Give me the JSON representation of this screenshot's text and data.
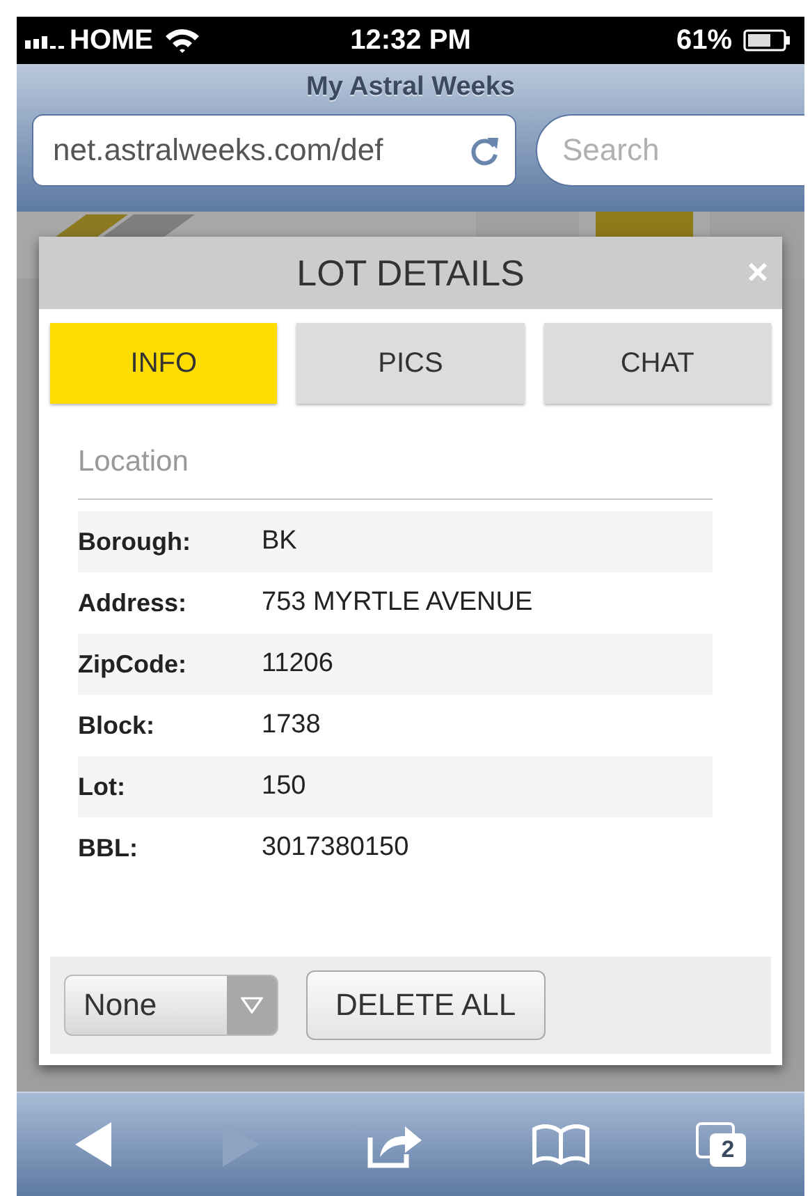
{
  "status_bar": {
    "carrier": "HOME",
    "time": "12:32 PM",
    "battery": "61%"
  },
  "browser": {
    "title": "My Astral Weeks",
    "url": "net.astralweeks.com/def",
    "search": {
      "placeholder": "Search"
    }
  },
  "modal": {
    "title": "LOT DETAILS",
    "close": "×",
    "tabs": [
      {
        "label": "INFO",
        "selected": true
      },
      {
        "label": "PICS",
        "selected": false
      },
      {
        "label": "CHAT",
        "selected": false
      }
    ],
    "section": "Location",
    "rows": [
      {
        "label": "Borough:",
        "value": "BK"
      },
      {
        "label": "Address:",
        "value": "753 MYRTLE AVENUE"
      },
      {
        "label": "ZipCode:",
        "value": "11206"
      },
      {
        "label": "Block:",
        "value": "1738"
      },
      {
        "label": "Lot:",
        "value": "150"
      },
      {
        "label": "BBL:",
        "value": "3017380150"
      }
    ],
    "select": {
      "value": "None"
    },
    "button": "DELETE ALL"
  },
  "toolbar": [
    {
      "kind": "back",
      "disabled": false
    },
    {
      "kind": "forward",
      "disabled": true
    },
    {
      "kind": "share",
      "disabled": false
    },
    {
      "kind": "bookmarks",
      "disabled": false
    },
    {
      "kind": "tabs",
      "disabled": false,
      "count": "2"
    }
  ]
}
